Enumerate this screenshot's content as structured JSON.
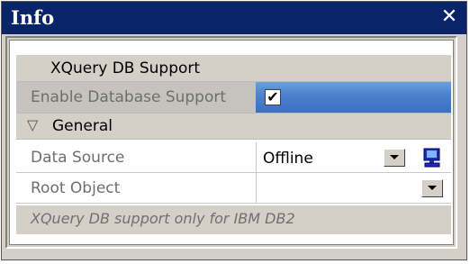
{
  "window": {
    "title": "Info",
    "close_glyph": "✕"
  },
  "panel": {
    "header": "XQuery DB Support",
    "enable_label": "Enable Database Support",
    "enable_checked": true,
    "group_toggle_glyph": "▽",
    "group_label": "General",
    "properties": [
      {
        "label": "Data Source",
        "value": "Offline"
      },
      {
        "label": "Root Object",
        "value": ""
      }
    ],
    "note": "XQuery DB support only for IBM DB2"
  },
  "icons": {
    "checkbox": "checkmark-icon",
    "dropdown": "dropdown-arrow-icon",
    "database": "database-connection-icon"
  },
  "colors": {
    "titlebar": "#0a246a",
    "selection": "#4a80cc",
    "panel_gray": "#d4d0c8"
  }
}
